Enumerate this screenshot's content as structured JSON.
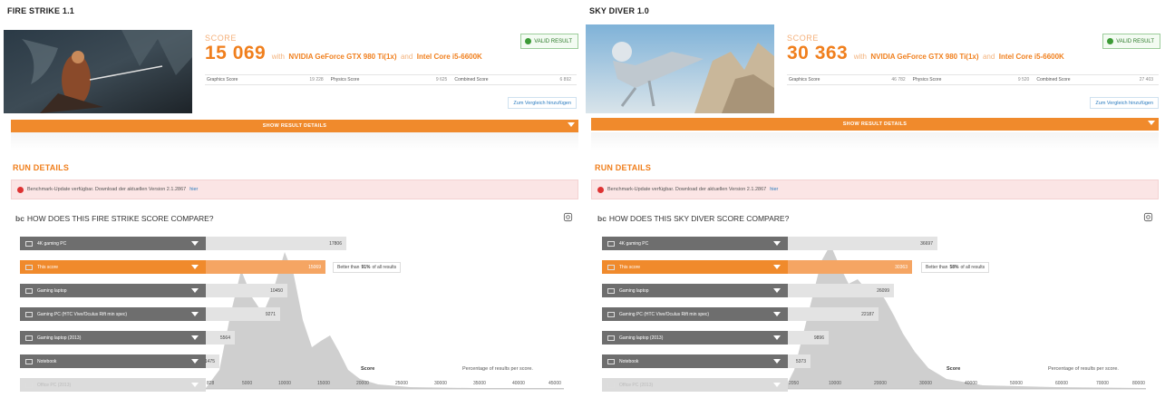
{
  "panels": [
    {
      "title": "FIRE STRIKE 1.1",
      "score_label": "SCORE",
      "score": "15 069",
      "with": "with",
      "gpu": "NVIDIA GeForce GTX 980 Ti(1x)",
      "and": "and",
      "cpu": "Intel Core i5-6600K",
      "valid": "VALID RESULT",
      "subscores": [
        {
          "label": "Graphics Score",
          "value": "19 228"
        },
        {
          "label": "Physics Score",
          "value": "9 625"
        },
        {
          "label": "Combined Score",
          "value": "6 892"
        }
      ],
      "compare_link": "Zum Vergleich hinzufügen",
      "show_details": "SHOW RESULT DETAILS",
      "run_details": "RUN DETAILS",
      "notice": "Benchmark-Update verfügbar. Download der aktuellen Version 2.1.2867",
      "notice_link": "hier",
      "compare_prefix": "bc",
      "compare_title": "HOW DOES THIS FIRE STRIKE SCORE COMPARE?",
      "rows": [
        {
          "label": "4K gaming PC",
          "value": "17806",
          "style": "grey"
        },
        {
          "label": "This score",
          "value": "15069",
          "style": "orange"
        },
        {
          "label": "Gaming laptop",
          "value": "10450",
          "style": "grey"
        },
        {
          "label": "Gaming PC (HTC Vive/Oculus Rift min spec)",
          "value": "9271",
          "style": "grey"
        },
        {
          "label": "Gaming laptop (2013)",
          "value": "5564",
          "style": "grey"
        },
        {
          "label": "Notebook",
          "value": "1475",
          "style": "grey"
        },
        {
          "label": "Office PC (2013)",
          "value": "",
          "style": "faded"
        }
      ],
      "better_prefix": "Better than",
      "better_pct": "91%",
      "better_suffix": "of all results",
      "axis_ticks": [
        "828",
        "5000",
        "10000",
        "15000",
        "20000",
        "25000",
        "30000",
        "35000",
        "40000",
        "45000"
      ],
      "axis_label": "Score",
      "pct_label": "Percentage of results per score."
    },
    {
      "title": "SKY DIVER 1.0",
      "score_label": "SCORE",
      "score": "30 363",
      "with": "with",
      "gpu": "NVIDIA GeForce GTX 980 Ti(1x)",
      "and": "and",
      "cpu": "Intel Core i5-6600K",
      "valid": "VALID RESULT",
      "subscores": [
        {
          "label": "Graphics Score",
          "value": "46 782"
        },
        {
          "label": "Physics Score",
          "value": "9 520"
        },
        {
          "label": "Combined Score",
          "value": "27 403"
        }
      ],
      "compare_link": "Zum Vergleich hinzufügen",
      "show_details": "SHOW RESULT DETAILS",
      "run_details": "RUN DETAILS",
      "notice": "Benchmark-Update verfügbar. Download der aktuellen Version 2.1.2867",
      "notice_link": "hier",
      "compare_prefix": "bc",
      "compare_title": "HOW DOES THIS SKY DIVER SCORE COMPARE?",
      "rows": [
        {
          "label": "4K gaming PC",
          "value": "36697",
          "style": "grey"
        },
        {
          "label": "This score",
          "value": "30363",
          "style": "orange"
        },
        {
          "label": "Gaming laptop",
          "value": "26099",
          "style": "grey"
        },
        {
          "label": "Gaming PC (HTC Vive/Oculus Rift min spec)",
          "value": "22187",
          "style": "grey"
        },
        {
          "label": "Gaming laptop (2013)",
          "value": "9896",
          "style": "grey"
        },
        {
          "label": "Notebook",
          "value": "5373",
          "style": "grey"
        },
        {
          "label": "Office PC (2013)",
          "value": "",
          "style": "faded"
        }
      ],
      "better_prefix": "Better than",
      "better_pct": "58%",
      "better_suffix": "of all results",
      "axis_ticks": [
        "2050",
        "10000",
        "20000",
        "30000",
        "40000",
        "50000",
        "60000",
        "70000",
        "80000"
      ],
      "axis_label": "Score",
      "pct_label": "Percentage of results per score."
    }
  ],
  "colors": {
    "accent": "#f08a2c",
    "valid_green": "#3c9a36",
    "notice_bg": "#fbe5e5"
  }
}
